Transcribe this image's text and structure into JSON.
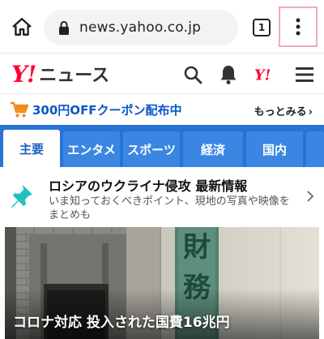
{
  "browser": {
    "url": "news.yahoo.co.jp",
    "tab_count": "1",
    "icons": {
      "home": "home-icon",
      "lock": "lock-icon",
      "menu": "more-vert-icon"
    }
  },
  "header": {
    "logo_mark": "Y!",
    "logo_text": "ニュース",
    "icons": [
      "search-icon",
      "bell-icon",
      "yahoo-y-icon",
      "hamburger-icon"
    ],
    "brand_color": "#ff0033"
  },
  "coupon": {
    "text": "300円OFFクーポン配布中",
    "more": "もっとみる",
    "more_arrow": "›"
  },
  "categories": {
    "items": [
      {
        "label": "主要",
        "active": true
      },
      {
        "label": "エンタメ",
        "active": false
      },
      {
        "label": "スポーツ",
        "active": false
      },
      {
        "label": "経済",
        "active": false
      },
      {
        "label": "国内",
        "active": false
      }
    ],
    "bar_color": "#2873d6"
  },
  "breaking": {
    "title": "ロシアのウクライナ侵攻 最新情報",
    "subtitle": "いま知っておくべきポイント、現地の写真や映像をまとめも"
  },
  "hero": {
    "plaque_chars": [
      "財",
      "務"
    ],
    "caption": "コロナ対応 投入された国費16兆円"
  }
}
